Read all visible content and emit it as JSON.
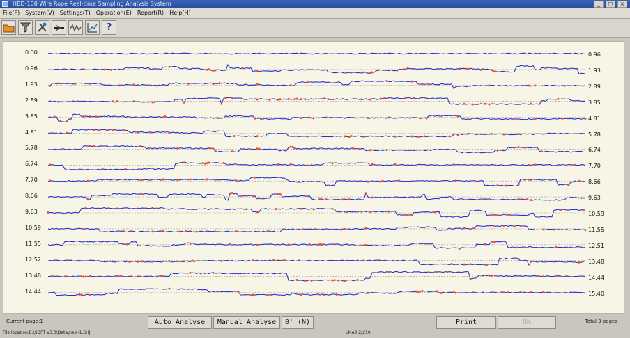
{
  "window": {
    "title": "HBD-100 Wire Rope Real-time Sampling Analysis System"
  },
  "menu": [
    "File(F)",
    "System(V)",
    "Settings(T)",
    "Operation(E)",
    "Report(R)",
    "Help(H)"
  ],
  "toolbar": {
    "buttons": [
      {
        "icon": "open-folder-icon"
      },
      {
        "icon": "filter-funnel-icon"
      },
      {
        "icon": "tools-icon"
      },
      {
        "icon": "sampling-wire-icon"
      },
      {
        "icon": "wave-analysis-icon"
      },
      {
        "icon": "chart-trend-icon"
      },
      {
        "icon": "help-question-icon"
      }
    ],
    "help_glyph": "?"
  },
  "plot": {
    "left_labels": [
      "0.00",
      "0.96",
      "1.93",
      "2.89",
      "3.85",
      "4.81",
      "5.78",
      "6.74",
      "7.70",
      "8.66",
      "9.63",
      "10.59",
      "11.55",
      "12.52",
      "13.48",
      "14.44"
    ],
    "right_labels": [
      "0.96",
      "1.93",
      "2.89",
      "3.85",
      "4.81",
      "5.78",
      "6.74",
      "7.70",
      "8.66",
      "9.63",
      "10.59",
      "11.55",
      "12.51",
      "13.48",
      "14.44",
      "15.40"
    ],
    "trace_color": "#2f2fd0",
    "marker_color": "#e8503a",
    "background_color": "#f7f6e6"
  },
  "status": {
    "current_page": "Current page:1",
    "file_location": "File location:E:\\SOFT V3.0\\Data\\new-1.SHJ",
    "lma": "LMA0.2/210",
    "total_pages": "Total 3 pages"
  },
  "buttons": {
    "auto_analyse": "Auto Analyse",
    "manual_analyse": "Manual Analyse",
    "zero_n": "0' (N)",
    "print": "Print",
    "ok": "OK"
  }
}
